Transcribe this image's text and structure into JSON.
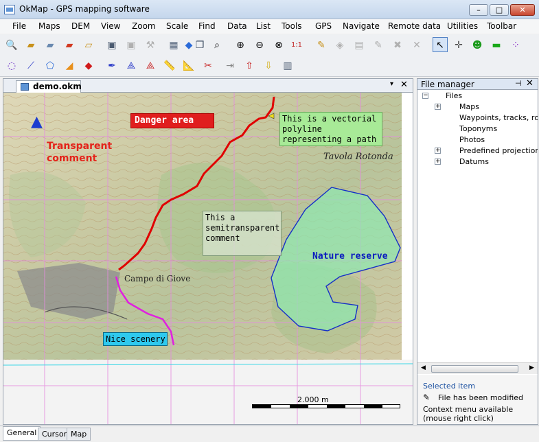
{
  "window": {
    "title": "OkMap - GPS mapping software",
    "minimize_glyph": "–",
    "maximize_glyph": "□",
    "close_glyph": "✕"
  },
  "menu": [
    "File",
    "Maps",
    "DEM",
    "View",
    "Zoom",
    "Scale",
    "Find",
    "Data",
    "List",
    "Tools",
    "GPS",
    "Navigate",
    "Remote data",
    "Utilities",
    "Toolbar"
  ],
  "toolbar_icons": [
    "zoom-icon",
    "open-folder-icon",
    "map-folder-icon",
    "folder-red-icon",
    "folder-open-icon",
    "save-disk-icon",
    "save-disk-disabled-icon",
    "tools-disabled-icon",
    "calculator-icon",
    "paint-bucket-icon",
    "window-icon",
    "magnifier-icon",
    "zoom-in-icon",
    "zoom-out-icon",
    "zoom-fit-icon",
    "zoom-1to1-icon",
    "pencil-grid-icon",
    "waypoint-icon",
    "layers-icon",
    "edit-disabled-icon",
    "delete-disabled-icon",
    "remove-disabled-icon",
    "pointer-icon",
    "crosshair-icon",
    "smiley-icon",
    "comment-icon",
    "nodes-icon",
    "circle-draw-icon",
    "polyline-draw-icon",
    "polygon-draw-icon",
    "eraser-icon",
    "diamond-icon",
    "pen-icon",
    "node-edit-icon",
    "node-delete-icon",
    "ruler-icon",
    "ruler-area-icon",
    "ruler-delete-icon",
    "import-icon",
    "gps-upload-icon",
    "gps-download-icon",
    "gps-device-icon"
  ],
  "document": {
    "tab_label": "demo.okm",
    "dropdown_glyph": "▾",
    "close_glyph": "✕"
  },
  "map": {
    "danger_label": "Danger area",
    "polyline_comment": "This is a vectorial polyline representing a path",
    "semitransparent_comment": "This a semitransparent comment",
    "transparent_comment": "Transparent comment",
    "nature_reserve": "Nature reserve",
    "scenery_label": "Nice scenery",
    "place_campo": "Campo di Giove",
    "place_tavola": "Tavola Rotonda",
    "scale_label": "2.000 m",
    "north_glyph": "▲",
    "colors": {
      "path": "#e00000",
      "scenery_path": "#e020e0",
      "reserve_fill": "#8ee8b0",
      "reserve_stroke": "#1530c8",
      "grid_pink": "#e58ce0"
    }
  },
  "file_manager": {
    "title": "File manager",
    "pin_glyph": "⊣",
    "close_glyph": "✕",
    "root": "Files",
    "items": [
      {
        "label": "Maps",
        "expandable": true
      },
      {
        "label": "Waypoints, tracks, routes",
        "expandable": false
      },
      {
        "label": "Toponyms",
        "expandable": false
      },
      {
        "label": "Photos",
        "expandable": false
      },
      {
        "label": "Predefined projections",
        "expandable": true
      },
      {
        "label": "Datums",
        "expandable": true
      }
    ],
    "selected_item_title": "Selected item",
    "modified_text": "File has been modified",
    "context_text": "Context menu available (mouse right click)"
  },
  "bottom_tabs": [
    "General",
    "Cursor",
    "Map"
  ]
}
